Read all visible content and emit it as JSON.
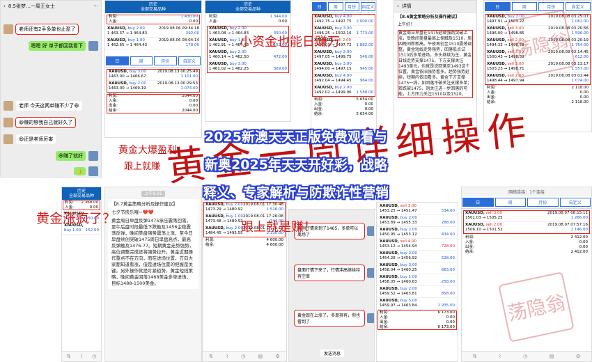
{
  "chat1": {
    "title": "8.5张梦…一周王女士",
    "messages": [
      {
        "text": "老师还有2手多单也止盈了",
        "side": "left"
      },
      {
        "text": "嗯嗯 好 单子都回我看下",
        "side": "right"
      },
      {
        "text": "老师 今天这两单赚不少了😆",
        "side": "left"
      },
      {
        "text": "😆赚的够我自己就好久了",
        "side": "left"
      },
      {
        "text": "😆还是老师厉害",
        "side": "left"
      },
      {
        "text": "😆赚了就好",
        "side": "right"
      },
      {
        "text": "👍",
        "side": "right"
      }
    ]
  },
  "mt1": {
    "title": "历史",
    "subtitle": "全部交易品种",
    "summary": [
      {
        "label": "利润:",
        "value": "1 430.00"
      },
      {
        "label": "入金:",
        "value": "0.00"
      }
    ],
    "trades": [
      {
        "sym": "XAUUSD,",
        "dir": "buy 2.00",
        "time": "2019.08.06 09:34:18",
        "price": "1 463.37 → 1 464.83",
        "pl": "292.00"
      },
      {
        "sym": "XAUUSD,",
        "dir": "buy 1.00",
        "time": "2019.08.06 08:04:14",
        "price": "1 462.65 → 1 464.43",
        "pl": "178.00"
      }
    ],
    "tabs": [
      "日",
      "周",
      "月份",
      "自定义"
    ],
    "trades2": [
      {
        "sym": "XAUUSD,",
        "dir": "buy 3.00",
        "time": "2019.08.13 00:25:49",
        "price": "1463.00 → 1466.67",
        "pl": "1 101.00"
      },
      {
        "sym": "XAUUSD,",
        "dir": "buy 2.00",
        "time": "2019.08.13 00:29:53",
        "price": "1463.00 → 1469.19",
        "pl": "1 074.00"
      }
    ],
    "summary2": [
      {
        "label": "利润:",
        "value": "2044.00"
      },
      {
        "label": "入金:",
        "value": "0.00"
      },
      {
        "label": "出金:",
        "value": "0.00"
      },
      {
        "label": "结余:",
        "value": "2044.00"
      }
    ]
  },
  "mt2": {
    "title": "历史",
    "subtitle": "全部交易品种",
    "summary": [
      {
        "label": "利润:",
        "value": "1 344.00"
      },
      {
        "label": "入金:",
        "value": "0.00"
      }
    ],
    "trades": [
      {
        "sym": "XAUUSD,",
        "dir": "buy 2.00",
        "time": "2019.08.06 09:34:18",
        "price": "1 463.08 → 1 464.83",
        "pl": "350.00"
      },
      {
        "sym": "XAUUSD,",
        "dir": "buy 1.00",
        "time": "2019.08.06 08:04:18",
        "price": "1 462.91 → 1 464.43",
        "pl": "152.00"
      },
      {
        "sym": "XAUUSD,",
        "dir": "buy 2.00",
        "time": "2019.08.06 07:59:17",
        "price": "1 460.14 → 1 462.50",
        "pl": "472.00"
      },
      {
        "sym": "XAUUSD,",
        "dir": "buy 3.00",
        "time": "2019.08.06 05:13:42",
        "price": "1 461.02 → 1 462.25",
        "pl": "369.00"
      }
    ]
  },
  "mt3": {
    "tabs": [
      "日",
      "周",
      "月份",
      "自定义"
    ],
    "trades": [
      {
        "sym": "XAUUSD,",
        "dir": "buy 4.00",
        "time": "2019.08.08 03:36:44",
        "price": "1492.75 → 1497.75",
        "pl": "2 000.00"
      },
      {
        "sym": "XAUUSD,",
        "dir": "buy 3.00",
        "time": "2019.08.08 03:36:28",
        "price": "1496.25 → 1502.16",
        "pl": "1 773.00"
      },
      {
        "sym": "XAUUSD,",
        "dir": "sell 2.00",
        "time": "2019.08.08 03:28:49",
        "price": "1492.03 → 1497.72",
        "pl": "1 882.00"
      },
      {
        "sym": "XAUUSD,",
        "dir": "buy 2.00",
        "time": "2019.08.08 03:30:56",
        "price": "1497.05 → 1499.75",
        "pl": "540.00"
      },
      {
        "sym": "XAUUSD,",
        "dir": "buy 3.00",
        "time": "2019.08.08 03:27:09",
        "price": "1494.00 → 1497.15",
        "pl": "945.00"
      },
      {
        "sym": "XAUUSD,",
        "dir": "buy 4.00",
        "time": "2019.08.08 03:26:13",
        "price": "1492.04 → 1494.45",
        "pl": "964.00"
      },
      {
        "sym": "XAUUSD,",
        "dir": "buy 2.00",
        "time": "2019.08.08 03:25:40",
        "price": "1492.02 → 1499.96",
        "pl": "1 588.00"
      }
    ],
    "summary": [
      {
        "label": "利润:",
        "value": "5 654.00"
      },
      {
        "label": "入金:",
        "value": "0.00"
      },
      {
        "label": "出金:",
        "value": "0.00"
      },
      {
        "label": "结余:",
        "value": "5 654.00"
      }
    ]
  },
  "doc1": {
    "header": "详情",
    "title": "【8.6黄金策略分析及操作建议】",
    "greeting": "上午好！",
    "body": "黄金周日早盘在1475延续强劲突破上涨，受晚间美盘最高上探触及1510，周四晚间新新高。午夜再创至1510震荡调整。黄金短线走势强势，回落低点试1510后多单进场，多头继续为主，黄金日线走势支撑1475，下方支撑关注1493美元，也就是说回落至1493这个位置，黄金依旧强势看多。趋势强势延续，短期内依旧看多。黄金下方支撑1475一线，如回落不破关注支撑多单；若跌破1475，则关注进一步回落的可能，上方压力关注1510以及1520。"
  },
  "mt4": {
    "tabs": [
      "日",
      "周",
      "月份",
      "自定义"
    ],
    "trades": [
      {
        "sym": "XAUUSD,",
        "dir": "buy 2.00",
        "time": "2019.08.08 03:25:07",
        "price": "1497.91 → 1503.22",
        "pl": "1 062.00"
      },
      {
        "sym": "XAUUSD,",
        "dir": "sell 3.00",
        "time": "2019.08.08 03:20:56",
        "price": "1496.00 → 1498.85",
        "pl": "1 596.00"
      },
      {
        "sym": "XAUUSD,",
        "dir": "sell 2.00",
        "time": "2019.08.08 03:20:19",
        "price": "1494.33 → 1498.78",
        "pl": "1 764.00"
      },
      {
        "sym": "XAUUSD,",
        "dir": "sell 3.00",
        "time": "2019.08.08 03:14:45",
        "price": "1500.43 → 1498.39",
        "pl": "612.00"
      },
      {
        "sym": "XAUUSD,",
        "dir": "sell 3.00",
        "time": "2019.08.08 03:13:17",
        "price": "1503.23 → 1498.71",
        "pl": "1 557.00"
      },
      {
        "sym": "XAUUSD,",
        "dir": "sell 2.00",
        "time": "2019.08.08 03:01:44",
        "price": "1498.44 → 1497.94",
        "pl": "1 074.00"
      }
    ],
    "summary": [
      {
        "label": "利润:",
        "value": "2 118.00"
      },
      {
        "label": "入金:",
        "value": "0.00"
      },
      {
        "label": "出金:",
        "value": "0.00"
      },
      {
        "label": "结余:",
        "value": "2 118.00"
      }
    ]
  },
  "mt5": {
    "title": "历史",
    "subtitle": "全部交易品种",
    "summary": [
      {
        "label": "利润:",
        "value": "2 368.00"
      },
      {
        "label": "入金:",
        "value": "0.00"
      }
    ],
    "trades": [
      {
        "sym": "XAUUSD,",
        "dir": "buy 2.00",
        "time": "2019.08.06 09:34:18",
        "price": "1 463.08 → 1 464.83",
        "pl": "350.00"
      },
      {
        "sym": "XAUUSD,",
        "dir": "buy 1.00",
        "time": "2019.08.06 08:04:18",
        "price": "1 462.91 → 1 464.43",
        "pl": "152.00"
      }
    ]
  },
  "doc2": {
    "time": "上午9:31",
    "title": "【8.7黄金策略分析及操作建议】",
    "greeting": "七夕节快乐哦~❤️❤️",
    "body": "黄金周日早盘反弹1475承压震荡回落，至午后盘时段最低下跌触及1456企稳震荡反弹，晚间美盘强势震荡上涨，至今日早盘续创突破1475周日早盘高点，最高反弹触及1476-77。短期黄金走势强势，高位调整完成还将强势拉升。黄金近期操作重点不在方向，而在进场位置，方向大家都知道看涨，但是进场位置的把握是关键。另外操作就是盯紧趋势，黄金短线策略，晚间黄金回落1468美金多单进场，目标1488-1500美金。"
  },
  "mt6": {
    "trades": [
      {
        "sym": "XAUUSD,",
        "dir": "buy 2.00",
        "time": "2019.08.01 17:30:48",
        "price": "1473.29 → 1480.92",
        "pl": "1 526.00"
      },
      {
        "sym": "XAUUSD,",
        "dir": "buy 1.00",
        "time": "2019.08.01 17:26:08",
        "price": "1473.48 → 1480.92",
        "pl": "744.00"
      },
      {
        "sym": "XAUUSD,",
        "dir": "buy 2.00",
        "time": "2019.08.01 17:21:14",
        "price": "1484.45 → 1495.55",
        "pl": "2 330.00"
      }
    ],
    "summary": [
      {
        "label": "利润:",
        "value": "4 600.00"
      },
      {
        "label": "结余:",
        "value": "4 600.00"
      }
    ]
  },
  "chat2": {
    "messages": [
      {
        "text": "刚刚行情来到了1465，多单可以离场了",
        "side": "left"
      },
      {
        "text": "盘面行情下来了，行情冲高继续持有空单",
        "side": "left"
      },
      {
        "text": "黄金现在上涨了，多单持有，你也看到了",
        "side": "left"
      }
    ],
    "button": "发送消息"
  },
  "mt7": {
    "trades": [
      {
        "sym": "XAUUSD,",
        "dir": "sell 3.00",
        "time": "2019.08.06 10:24:30",
        "price": "1453.25 → 1451.47",
        "pl": "534.00"
      },
      {
        "sym": "XAUUSD,",
        "dir": "buy 2.00",
        "time": "2019.08.06 09:24:18",
        "price": "1453.89 → 1455.33",
        "pl": "288.00"
      },
      {
        "sym": "XAUUSD,",
        "dir": "buy 2.00",
        "time": "2019.08.06 09:05:00",
        "price": "1450.95 → 1453.12",
        "pl": "434.00"
      },
      {
        "sym": "XAUUSD,",
        "dir": "sell 4.00",
        "time": "2019.08.06 08:02:42",
        "price": "1453.12 → 1454.94",
        "pl": "-728.00"
      },
      {
        "sym": "XAUUSD,",
        "dir": "buy 2.00",
        "time": "2019.08.06 07:57:00",
        "price": "1454.28 → 1456.92",
        "pl": "528.00"
      },
      {
        "sym": "XAUUSD,",
        "dir": "buy 3.00",
        "time": "2019.08.06 07:47:12",
        "price": "1458.04 → 1460.25",
        "pl": "663.00"
      },
      {
        "sym": "XAUUSD,",
        "dir": "buy 1.00",
        "time": "2019.08.06 07:45:28",
        "price": "1458.05 → 1460.63",
        "pl": "258.00"
      },
      {
        "sym": "XAUUSD,",
        "dir": "buy 2.00",
        "time": "2019.08.06 07:41:35",
        "price": "1459.52 → 1463.81",
        "pl": "858.00"
      },
      {
        "sym": "XAUUSD,",
        "dir": "buy 5.00",
        "time": "2019.08.06 07:39:06",
        "price": "1459.97 → 1463.84",
        "pl": "1 935.00"
      }
    ],
    "summary": [
      {
        "label": "利润:",
        "value": "6 173.00"
      },
      {
        "label": "入金:",
        "value": "0.00"
      },
      {
        "label": "出金:",
        "value": "0.00"
      },
      {
        "label": "结余:",
        "value": "6 173.00"
      }
    ]
  },
  "mt8": {
    "status": "网络连接：1个连接",
    "tabs": [
      "日",
      "周",
      "月份",
      "自定义"
    ],
    "trades": [
      {
        "sym": "XAUUSD,",
        "dir": "sell 3.00",
        "time": "2019.08.07 08:15:11",
        "price": "1501.03 → 1505.25",
        "pl": "1 266.00"
      },
      {
        "sym": "XAUUSD,",
        "dir": "sell 2.00",
        "time": "2019.08.07 07:57:16",
        "price": "1506.10 → 1501.52",
        "pl": "1 146.00"
      }
    ],
    "summary": [
      {
        "label": "利润:",
        "value": "2 412.00"
      },
      {
        "label": "入金:",
        "value": "0.00"
      },
      {
        "label": "出金:",
        "value": "0.00"
      },
      {
        "label": "结余:",
        "value": "2 412.00"
      }
    ]
  },
  "vertical_texts": {
    "left_top": "黄金大爆盈利",
    "left_top2": "跟上就赚",
    "left_bottom": "黄金涨疯了？",
    "middle_top": "小资金也能日赚万",
    "middle_bottom": "跟上就是赚！"
  },
  "big_red_text": "黄金一周详细操作",
  "stamp_text": "荡隐翁",
  "overlay": {
    "line1": "2025新澳天天正版免费观看与",
    "line2": "新奥2025年天天开好彩，战略",
    "line3": "释义、专家解析与防欺诈性营销"
  },
  "colors": {
    "mt_blue": "#0f62b8",
    "accent_red": "#e0261c",
    "overlay_stroke": "#2a3fd0"
  }
}
